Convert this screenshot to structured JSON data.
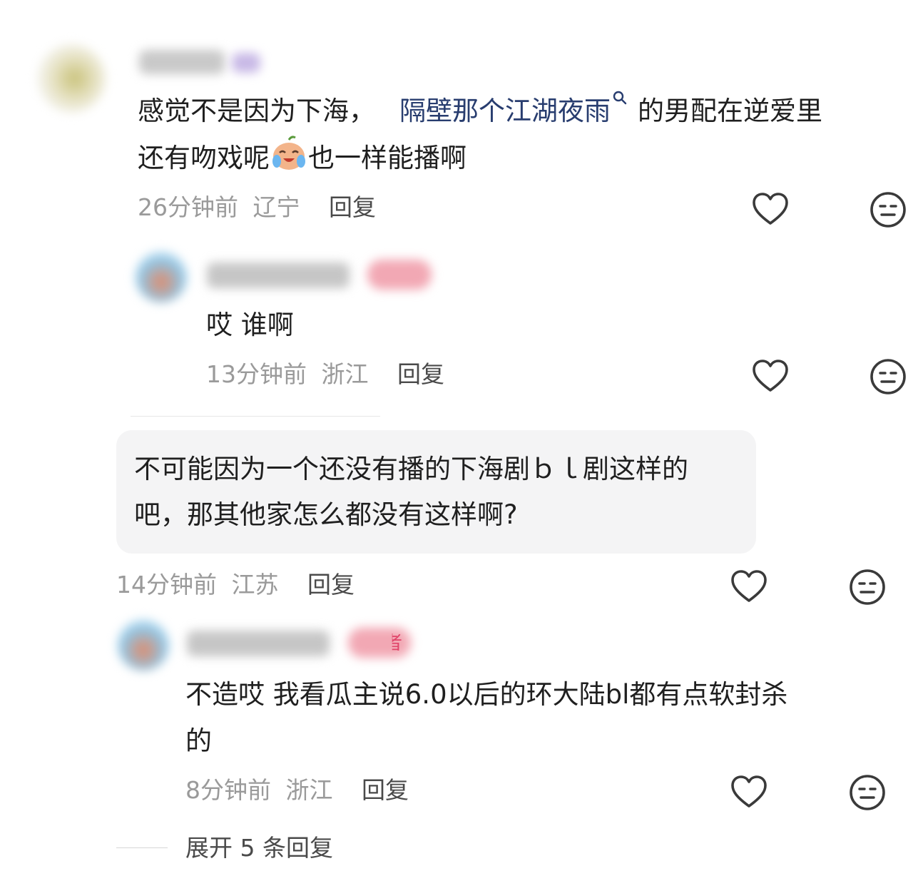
{
  "comments": [
    {
      "author": "",
      "text_prefix": "感觉不是因为下海，",
      "link_text": "隔壁那个江湖夜雨",
      "text_suffix": "的男配在逆爱里",
      "text_line2_prefix": "还有吻戏呢",
      "emoji": "crying-laughing-emoji",
      "text_line2_suffix": "也一样能播啊",
      "time": "26分钟前",
      "location": "辽宁",
      "reply": "回复"
    },
    {
      "author": "",
      "text": "哎 谁啊",
      "time": "13分钟前",
      "location": "浙江",
      "reply": "回复"
    },
    {
      "text_line1": "不可能因为一个还没有播的下海剧ｂｌ剧这样的",
      "text_line2": "吧，那其他家怎么都没有这样啊?",
      "time": "14分钟前",
      "location": "江苏",
      "reply": "回复"
    },
    {
      "author": "",
      "badge_visible_char": "者",
      "text_line1": "不造哎 我看瓜主说6.0以后的环大陆bl都有点软封杀",
      "text_line2": "的",
      "time": "8分钟前",
      "location": "浙江",
      "reply": "回复"
    }
  ],
  "expand_replies": "展开 5 条回复",
  "icons": {
    "like": "heart-outline-icon",
    "dislike": "meh-face-icon",
    "search": "search-icon"
  },
  "colors": {
    "link": "#283d6f",
    "meta": "#9a9a9a",
    "badge": "#f2a8b4",
    "bubble": "#f4f4f5"
  }
}
